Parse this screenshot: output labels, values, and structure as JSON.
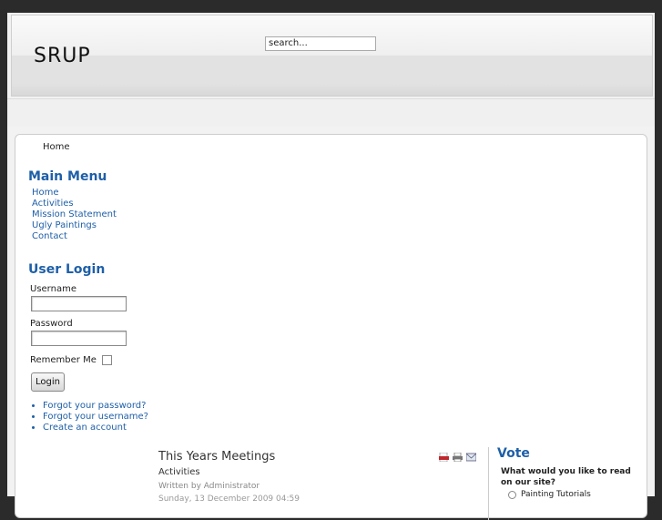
{
  "header": {
    "logo": "SRUP",
    "search_value": "search..."
  },
  "breadcrumb": {
    "home": "Home"
  },
  "main_menu": {
    "title": "Main Menu",
    "items": [
      "Home",
      "Activities",
      "Mission Statement",
      "Ugly Paintings",
      "Contact"
    ]
  },
  "login": {
    "title": "User Login",
    "username_label": "Username",
    "password_label": "Password",
    "remember_label": "Remember Me",
    "button": "Login",
    "links": [
      "Forgot your password?",
      "Forgot your username?",
      "Create an account"
    ]
  },
  "article": {
    "title": "This Years Meetings",
    "category": "Activities",
    "author": "Written by Administrator",
    "date": "Sunday, 13 December 2009 04:59"
  },
  "vote": {
    "title": "Vote",
    "question": "What would you like to read on our site?",
    "option1": "Painting Tutorials"
  },
  "icons": {
    "pdf": "pdf-icon",
    "print": "print-icon",
    "email": "email-icon"
  }
}
